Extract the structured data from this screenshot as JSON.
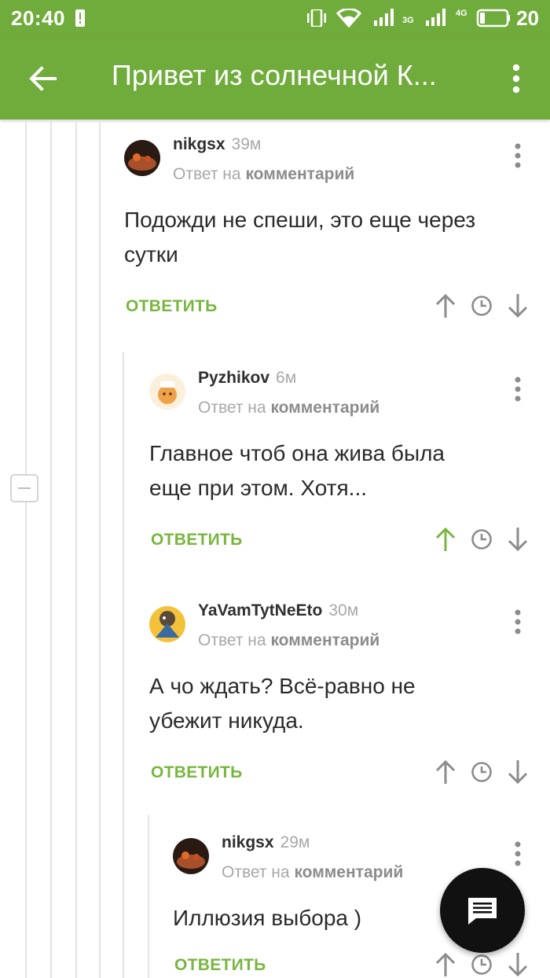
{
  "status_bar": {
    "time": "20:40",
    "battery_level": "20",
    "network_3g": "3G",
    "network_4g": "4G"
  },
  "app_bar": {
    "title": "Привет из солнечной К...",
    "background_color": "#70ac3c"
  },
  "comments": [
    {
      "author": "nikgsx",
      "age": "39м",
      "reply_prefix": "Ответ на",
      "reply_target": "комментарий",
      "text_lines": [
        "Подожди не спеши, это еще через",
        "сутки"
      ],
      "reply_label": "ОТВЕТИТЬ",
      "upvoted": false
    },
    {
      "author": "Pyzhikov",
      "age": "6м",
      "reply_prefix": "Ответ на",
      "reply_target": "комментарий",
      "text_lines": [
        "Главное чтоб она жива была",
        "еще при этом. Хотя..."
      ],
      "reply_label": "ОТВЕТИТЬ",
      "upvoted": true
    },
    {
      "author": "YaVamTytNeEto",
      "age": "30м",
      "reply_prefix": "Ответ на",
      "reply_target": "комментарий",
      "text_lines": [
        "А чо ждать? Всё-равно не",
        "убежит никуда."
      ],
      "reply_label": "ОТВЕТИТЬ",
      "upvoted": false
    },
    {
      "author": "nikgsx",
      "age": "29м",
      "reply_prefix": "Ответ на",
      "reply_target": "комментарий",
      "text_lines": [
        "Иллюзия выбора )"
      ],
      "reply_label": "ОТВЕТИТЬ",
      "upvoted": false
    }
  ],
  "colors": {
    "accent_green": "#79b63f",
    "vote_gray": "#8c8c8c",
    "fab": "#111111"
  },
  "icons": {
    "back": "arrow-left-icon",
    "overflow": "more-vertical-icon",
    "upvote": "arrow-up-icon",
    "downvote": "arrow-down-icon",
    "time": "clock-icon",
    "fab": "comment-icon"
  }
}
